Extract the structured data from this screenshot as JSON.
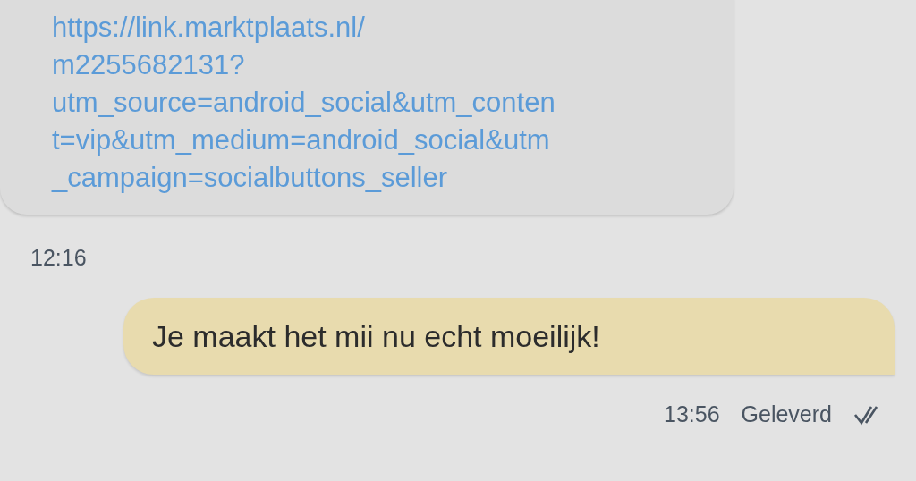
{
  "messages": [
    {
      "kind": "incoming",
      "link_lines": [
        "https://link.marktplaats.nl/",
        "m2255682131?",
        "utm_source=android_social&utm_conten",
        "t=vip&utm_medium=android_social&utm",
        "_campaign=socialbuttons_seller"
      ],
      "time": "12:16"
    },
    {
      "kind": "outgoing",
      "text": "Je maakt het mii nu echt moeilijk!",
      "time": "13:56",
      "status": "Geleverd",
      "delivered": true
    }
  ]
}
